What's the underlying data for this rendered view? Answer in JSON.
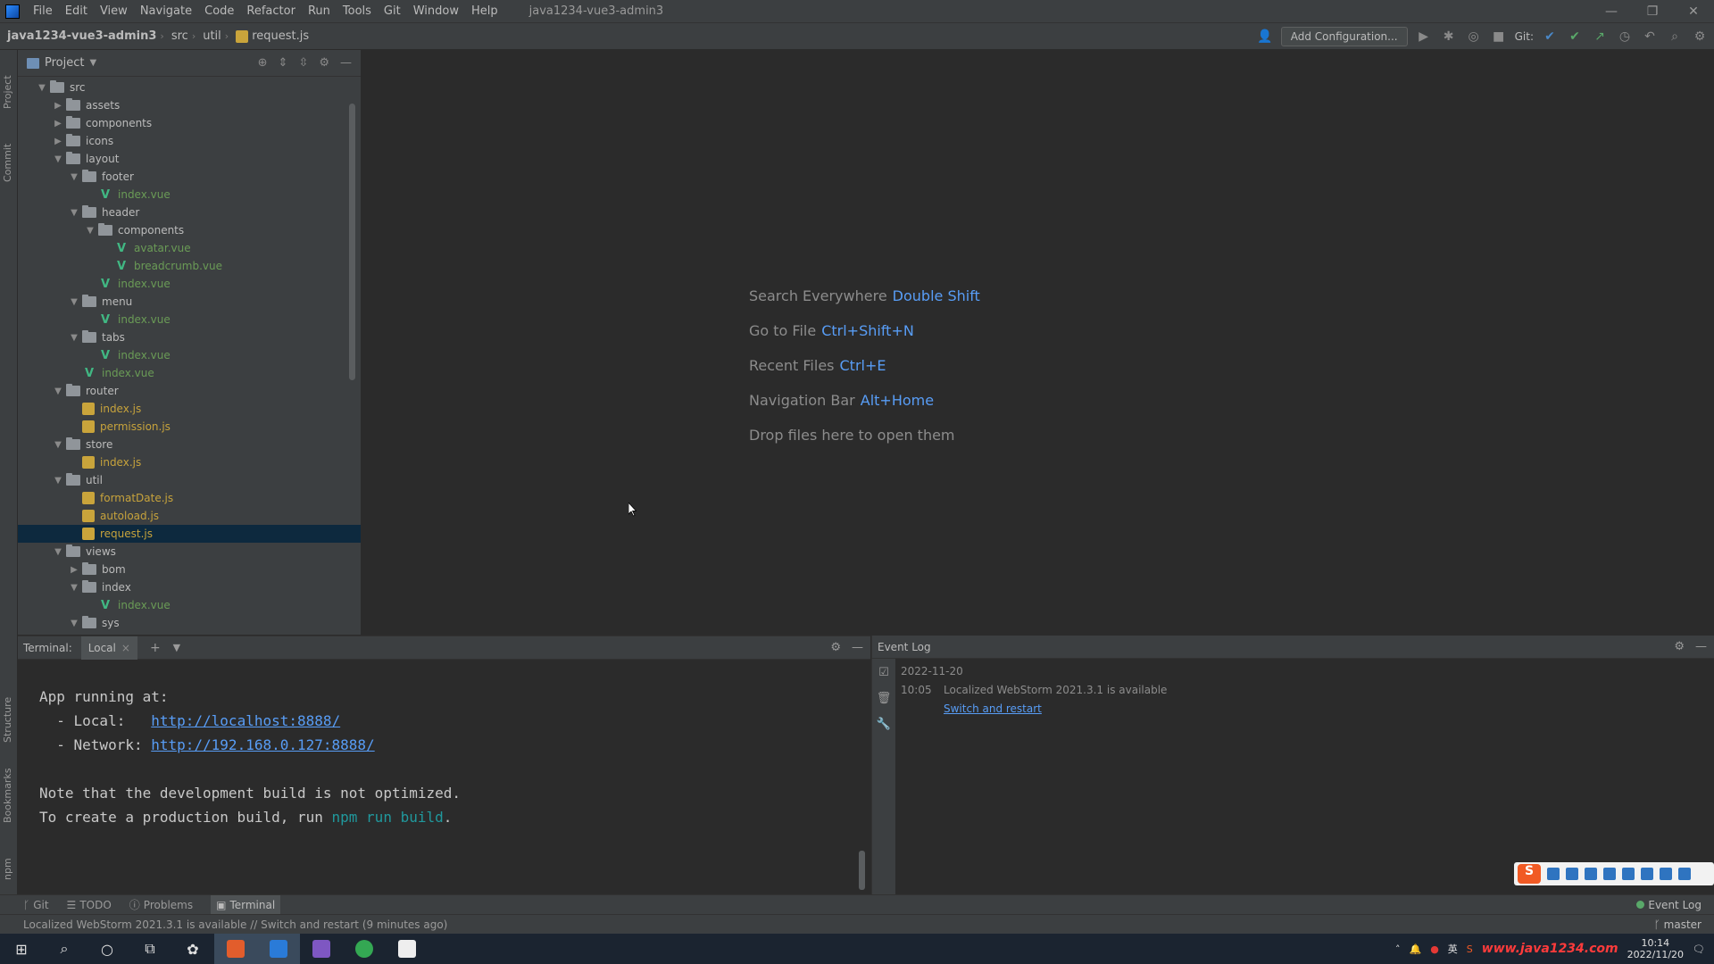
{
  "menu": [
    "File",
    "Edit",
    "View",
    "Navigate",
    "Code",
    "Refactor",
    "Run",
    "Tools",
    "Git",
    "Window",
    "Help"
  ],
  "window_title": "java1234-vue3-admin3",
  "window_controls": [
    "—",
    "❐",
    "✕"
  ],
  "breadcrumbs": [
    "java1234-vue3-admin3",
    "src",
    "util",
    "request.js"
  ],
  "toolbar": {
    "add_config": "Add Configuration...",
    "git_label": "Git:"
  },
  "left_stripe": [
    "Project",
    "Commit",
    "Structure",
    "Bookmarks",
    "npm"
  ],
  "project": {
    "title": "Project",
    "tree": [
      {
        "d": 1,
        "t": "folder",
        "n": "src",
        "a": "▼"
      },
      {
        "d": 2,
        "t": "folder",
        "n": "assets",
        "a": "▶"
      },
      {
        "d": 2,
        "t": "folder",
        "n": "components",
        "a": "▶"
      },
      {
        "d": 2,
        "t": "folder",
        "n": "icons",
        "a": "▶"
      },
      {
        "d": 2,
        "t": "folder",
        "n": "layout",
        "a": "▼"
      },
      {
        "d": 3,
        "t": "folder",
        "n": "footer",
        "a": "▼"
      },
      {
        "d": 4,
        "t": "vue",
        "n": "index.vue"
      },
      {
        "d": 3,
        "t": "folder",
        "n": "header",
        "a": "▼"
      },
      {
        "d": 4,
        "t": "folder",
        "n": "components",
        "a": "▼"
      },
      {
        "d": 5,
        "t": "vue",
        "n": "avatar.vue"
      },
      {
        "d": 5,
        "t": "vue",
        "n": "breadcrumb.vue"
      },
      {
        "d": 4,
        "t": "vue",
        "n": "index.vue"
      },
      {
        "d": 3,
        "t": "folder",
        "n": "menu",
        "a": "▼"
      },
      {
        "d": 4,
        "t": "vue",
        "n": "index.vue"
      },
      {
        "d": 3,
        "t": "folder",
        "n": "tabs",
        "a": "▼"
      },
      {
        "d": 4,
        "t": "vue",
        "n": "index.vue"
      },
      {
        "d": 3,
        "t": "vue",
        "n": "index.vue"
      },
      {
        "d": 2,
        "t": "folder",
        "n": "router",
        "a": "▼"
      },
      {
        "d": 3,
        "t": "js",
        "n": "index.js"
      },
      {
        "d": 3,
        "t": "js",
        "n": "permission.js"
      },
      {
        "d": 2,
        "t": "folder",
        "n": "store",
        "a": "▼"
      },
      {
        "d": 3,
        "t": "js",
        "n": "index.js"
      },
      {
        "d": 2,
        "t": "folder",
        "n": "util",
        "a": "▼"
      },
      {
        "d": 3,
        "t": "js",
        "n": "formatDate.js"
      },
      {
        "d": 3,
        "t": "js",
        "n": "autoload.js"
      },
      {
        "d": 3,
        "t": "js",
        "n": "request.js",
        "sel": true
      },
      {
        "d": 2,
        "t": "folder",
        "n": "views",
        "a": "▼"
      },
      {
        "d": 3,
        "t": "folder",
        "n": "bom",
        "a": "▶"
      },
      {
        "d": 3,
        "t": "folder",
        "n": "index",
        "a": "▼"
      },
      {
        "d": 4,
        "t": "vue",
        "n": "index.vue"
      },
      {
        "d": 3,
        "t": "folder",
        "n": "sys",
        "a": "▼"
      }
    ]
  },
  "welcome": [
    {
      "label": "Search Everywhere",
      "key": "Double Shift"
    },
    {
      "label": "Go to File",
      "key": "Ctrl+Shift+N"
    },
    {
      "label": "Recent Files",
      "key": "Ctrl+E"
    },
    {
      "label": "Navigation Bar",
      "key": "Alt+Home"
    },
    {
      "label": "Drop files here to open them",
      "key": ""
    }
  ],
  "terminal": {
    "tab_label": "Terminal:",
    "local_tab": "Local",
    "line1": "App running at:",
    "local_prefix": "  - Local:   ",
    "local_url": "http://localhost:8888/",
    "network_prefix": "  - Network: ",
    "network_url": "http://192.168.0.127:8888/",
    "note1": "Note that the development build is not optimized.",
    "note2_prefix": "To create a production build, run ",
    "note2_cmd": "npm run build",
    "note2_suffix": "."
  },
  "event_log": {
    "title": "Event Log",
    "date": "2022-11-20",
    "time": "10:05",
    "message": "Localized WebStorm 2021.3.1 is available",
    "link": "Switch and restart"
  },
  "tool_tabs": [
    "Git",
    "TODO",
    "Problems",
    "Terminal"
  ],
  "tool_right": "Event Log",
  "status": {
    "message": "Localized WebStorm 2021.3.1 is available // Switch and restart (9 minutes ago)",
    "branch": "master"
  },
  "taskbar": {
    "time": "10:14",
    "date": "2022/11/20",
    "watermark": "www.java1234.com"
  }
}
